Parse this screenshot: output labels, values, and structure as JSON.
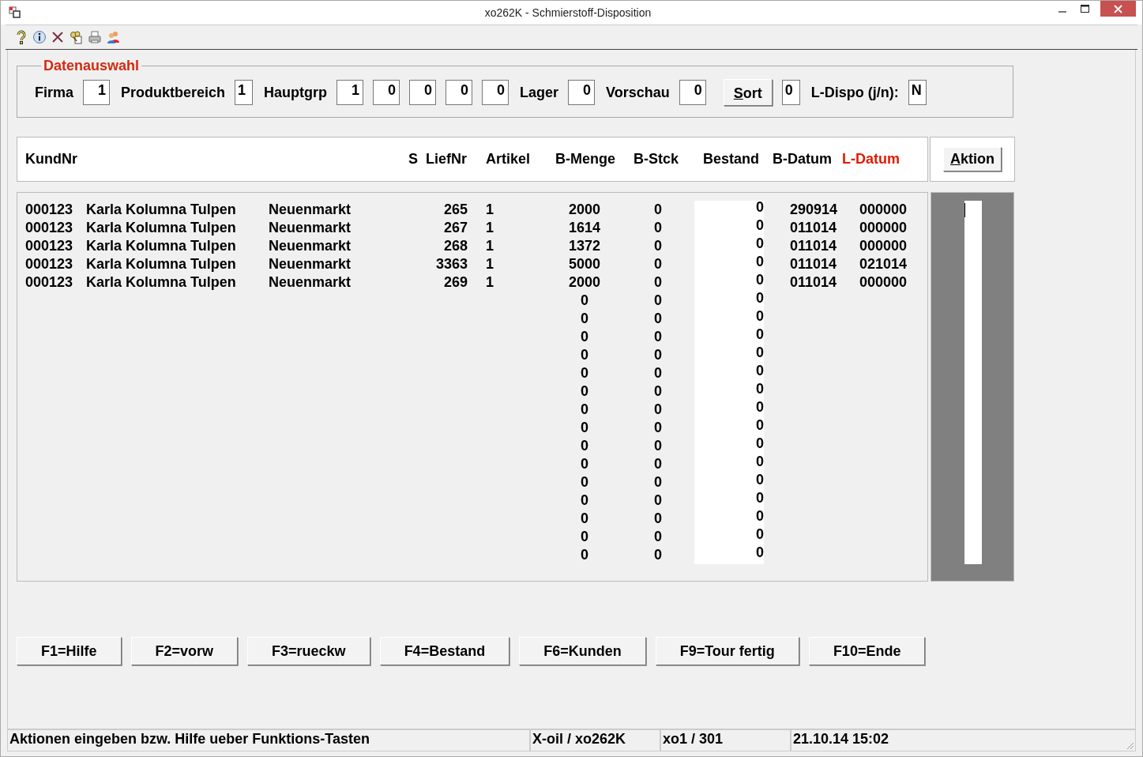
{
  "window": {
    "title": "xo262K - Schmierstoff-Disposition"
  },
  "selection": {
    "title": "Datenauswahl",
    "items": [
      {
        "kind": "label",
        "text": "Firma"
      },
      {
        "kind": "number_field",
        "value": "1"
      },
      {
        "kind": "label",
        "text": "Produktbereich"
      },
      {
        "kind": "char_field",
        "value": "1"
      },
      {
        "kind": "label",
        "text": "Hauptgrp"
      },
      {
        "kind": "number_field",
        "value": "1"
      },
      {
        "kind": "number_field",
        "value": "0"
      },
      {
        "kind": "number_field",
        "value": "0"
      },
      {
        "kind": "number_field",
        "value": "0"
      },
      {
        "kind": "number_field",
        "value": "0"
      },
      {
        "kind": "label",
        "text": "Lager"
      },
      {
        "kind": "number_field",
        "value": "0"
      },
      {
        "kind": "label",
        "text": "Vorschau"
      },
      {
        "kind": "number_field",
        "value": "0"
      },
      {
        "kind": "button",
        "text": "Sort",
        "underline_first": true
      },
      {
        "kind": "char_field",
        "value": "0"
      },
      {
        "kind": "label",
        "text": "L-Dispo (j/n):"
      },
      {
        "kind": "char_field",
        "value": "N"
      }
    ]
  },
  "table": {
    "columns": [
      {
        "label": "KundNr",
        "highlighted": false
      },
      {
        "label": "S",
        "highlighted": false
      },
      {
        "label": "LiefNr",
        "highlighted": false
      },
      {
        "label": "Artikel",
        "highlighted": false
      },
      {
        "label": "B-Menge",
        "highlighted": false
      },
      {
        "label": "B-Stck",
        "highlighted": false
      },
      {
        "label": "Bestand",
        "highlighted": false
      },
      {
        "label": "B-Datum",
        "highlighted": false
      },
      {
        "label": "L-Datum",
        "highlighted": true
      }
    ],
    "action_button": {
      "text": "Aktion",
      "underline_first": true
    },
    "rows": [
      {
        "kundnr": "000123",
        "name": "Karla Kolumna Tulpen",
        "ort": "Neuenmarkt",
        "liefnr": "265",
        "artikel": "1",
        "b_menge": "2000",
        "b_stck": "0",
        "bestand": "0",
        "b_datum": "290914",
        "l_datum": "000000"
      },
      {
        "kundnr": "000123",
        "name": "Karla Kolumna Tulpen",
        "ort": "Neuenmarkt",
        "liefnr": "267",
        "artikel": "1",
        "b_menge": "1614",
        "b_stck": "0",
        "bestand": "0",
        "b_datum": "011014",
        "l_datum": "000000"
      },
      {
        "kundnr": "000123",
        "name": "Karla Kolumna Tulpen",
        "ort": "Neuenmarkt",
        "liefnr": "268",
        "artikel": "1",
        "b_menge": "1372",
        "b_stck": "0",
        "bestand": "0",
        "b_datum": "011014",
        "l_datum": "000000"
      },
      {
        "kundnr": "000123",
        "name": "Karla Kolumna Tulpen",
        "ort": "Neuenmarkt",
        "liefnr": "3363",
        "artikel": "1",
        "b_menge": "5000",
        "b_stck": "0",
        "bestand": "0",
        "b_datum": "011014",
        "l_datum": "021014"
      },
      {
        "kundnr": "000123",
        "name": "Karla Kolumna Tulpen",
        "ort": "Neuenmarkt",
        "liefnr": "269",
        "artikel": "1",
        "b_menge": "2000",
        "b_stck": "0",
        "bestand": "0",
        "b_datum": "011014",
        "l_datum": "000000"
      },
      {
        "b_menge": "0",
        "b_stck": "0",
        "bestand": "0"
      },
      {
        "b_menge": "0",
        "b_stck": "0",
        "bestand": "0"
      },
      {
        "b_menge": "0",
        "b_stck": "0",
        "bestand": "0"
      },
      {
        "b_menge": "0",
        "b_stck": "0",
        "bestand": "0"
      },
      {
        "b_menge": "0",
        "b_stck": "0",
        "bestand": "0"
      },
      {
        "b_menge": "0",
        "b_stck": "0",
        "bestand": "0"
      },
      {
        "b_menge": "0",
        "b_stck": "0",
        "bestand": "0"
      },
      {
        "b_menge": "0",
        "b_stck": "0",
        "bestand": "0"
      },
      {
        "b_menge": "0",
        "b_stck": "0",
        "bestand": "0"
      },
      {
        "b_menge": "0",
        "b_stck": "0",
        "bestand": "0"
      },
      {
        "b_menge": "0",
        "b_stck": "0",
        "bestand": "0"
      },
      {
        "b_menge": "0",
        "b_stck": "0",
        "bestand": "0"
      },
      {
        "b_menge": "0",
        "b_stck": "0",
        "bestand": "0"
      },
      {
        "b_menge": "0",
        "b_stck": "0",
        "bestand": "0"
      },
      {
        "b_menge": "0",
        "b_stck": "0",
        "bestand": "0"
      }
    ]
  },
  "function_keys": [
    "F1=Hilfe",
    "F2=vorw",
    "F3=rueckw",
    "F4=Bestand",
    "F6=Kunden",
    "F9=Tour fertig",
    "F10=Ende"
  ],
  "status_bar": [
    "Aktionen eingeben bzw. Hilfe ueber Funktions-Tasten",
    "X-oil / xo262K",
    "xo1 / 301",
    "21.10.14 15:02"
  ]
}
